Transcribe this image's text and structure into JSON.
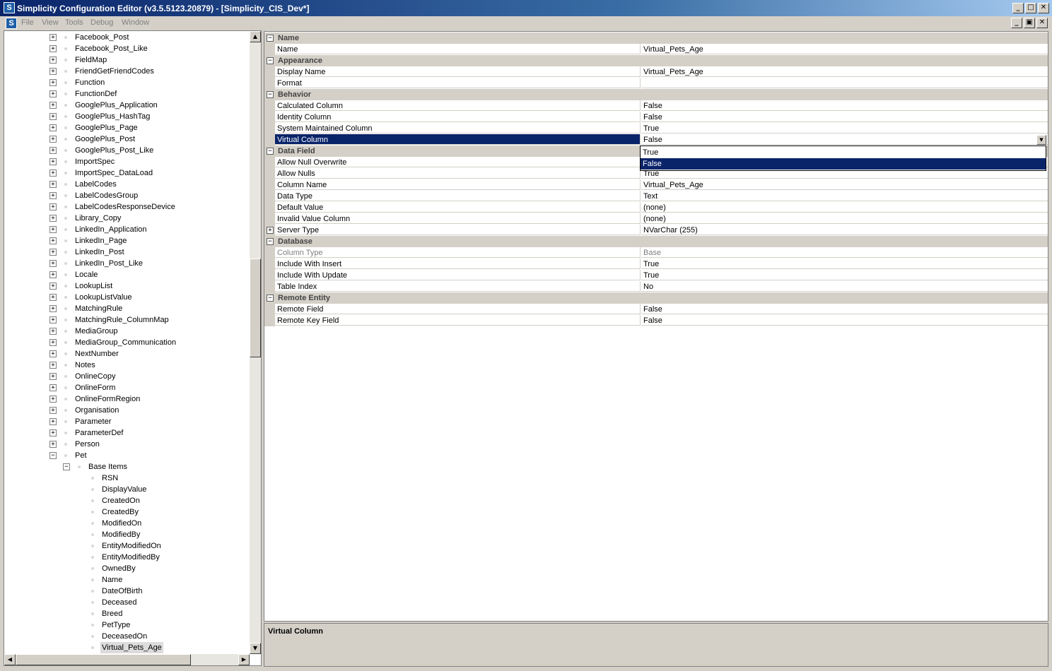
{
  "window": {
    "title": "Simplicity Configuration Editor (v3.5.5123.20879) - [Simplicity_CIS_Dev*]",
    "app_icon": "S",
    "minimize_glyph": "_",
    "maximize_glyph": "□",
    "close_glyph": "✕",
    "restore_glyph": "▣"
  },
  "menu": [
    "File",
    "View",
    "Tools",
    "Debug",
    "Window"
  ],
  "tree": {
    "top_items": [
      "Facebook_Post",
      "Facebook_Post_Like",
      "FieldMap",
      "FriendGetFriendCodes",
      "Function",
      "FunctionDef",
      "GooglePlus_Application",
      "GooglePlus_HashTag",
      "GooglePlus_Page",
      "GooglePlus_Post",
      "GooglePlus_Post_Like",
      "ImportSpec",
      "ImportSpec_DataLoad",
      "LabelCodes",
      "LabelCodesGroup",
      "LabelCodesResponseDevice",
      "Library_Copy",
      "LinkedIn_Application",
      "LinkedIn_Page",
      "LinkedIn_Post",
      "LinkedIn_Post_Like",
      "Locale",
      "LookupList",
      "LookupListValue",
      "MatchingRule",
      "MatchingRule_ColumnMap",
      "MediaGroup",
      "MediaGroup_Communication",
      "NextNumber",
      "Notes",
      "OnlineCopy",
      "OnlineForm",
      "OnlineFormRegion",
      "Organisation",
      "Parameter",
      "ParameterDef",
      "Person",
      "Pet"
    ],
    "group_label": "Base Items",
    "leaf_items": [
      "RSN",
      "DisplayValue",
      "CreatedOn",
      "CreatedBy",
      "ModifiedOn",
      "ModifiedBy",
      "EntityModifiedOn",
      "EntityModifiedBy",
      "OwnedBy",
      "Name",
      "DateOfBirth",
      "Deceased",
      "Breed",
      "PetType",
      "DeceasedOn",
      "Virtual_Pets_Age"
    ],
    "selected_item": "Virtual_Pets_Age",
    "expand_glyph": "+",
    "collapse_glyph": "−",
    "scroll_up": "▲",
    "scroll_down": "▼",
    "scroll_left": "◀",
    "scroll_right": "▶"
  },
  "properties": [
    {
      "kind": "cat",
      "label": "Name"
    },
    {
      "kind": "prop",
      "name": "Name",
      "value": "Virtual_Pets_Age"
    },
    {
      "kind": "cat",
      "label": "Appearance"
    },
    {
      "kind": "prop",
      "name": "Display Name",
      "value": "Virtual_Pets_Age"
    },
    {
      "kind": "prop",
      "name": "Format",
      "value": ""
    },
    {
      "kind": "cat",
      "label": "Behavior"
    },
    {
      "kind": "prop",
      "name": "Calculated Column",
      "value": "False"
    },
    {
      "kind": "prop",
      "name": "Identity Column",
      "value": "False"
    },
    {
      "kind": "prop",
      "name": "System Maintained Column",
      "value": "True"
    },
    {
      "kind": "prop",
      "name": "Virtual Column",
      "value": "False",
      "selected": true
    },
    {
      "kind": "cat",
      "label": "Data Field"
    },
    {
      "kind": "prop",
      "name": "Allow Null Overwrite",
      "value": ""
    },
    {
      "kind": "prop",
      "name": "Allow Nulls",
      "value": "True"
    },
    {
      "kind": "prop",
      "name": "Column Name",
      "value": "Virtual_Pets_Age"
    },
    {
      "kind": "prop",
      "name": "Data Type",
      "value": "Text"
    },
    {
      "kind": "prop",
      "name": "Default Value",
      "value": "(none)"
    },
    {
      "kind": "prop",
      "name": "Invalid Value Column",
      "value": "(none)"
    },
    {
      "kind": "prop",
      "name": "Server Type",
      "value": "NVarChar (255)",
      "expandable": true
    },
    {
      "kind": "cat",
      "label": "Database"
    },
    {
      "kind": "prop",
      "name": "Column Type",
      "value": "Base",
      "disabled": true
    },
    {
      "kind": "prop",
      "name": "Include With Insert",
      "value": "True"
    },
    {
      "kind": "prop",
      "name": "Include With Update",
      "value": "True"
    },
    {
      "kind": "prop",
      "name": "Table Index",
      "value": "No"
    },
    {
      "kind": "cat",
      "label": "Remote Entity"
    },
    {
      "kind": "prop",
      "name": "Remote Field",
      "value": "False"
    },
    {
      "kind": "prop",
      "name": "Remote Key Field",
      "value": "False"
    }
  ],
  "dropdown": {
    "options": [
      "True",
      "False"
    ],
    "selected": "False",
    "arrow_glyph": "▼"
  },
  "description": {
    "title": "Virtual Column"
  }
}
